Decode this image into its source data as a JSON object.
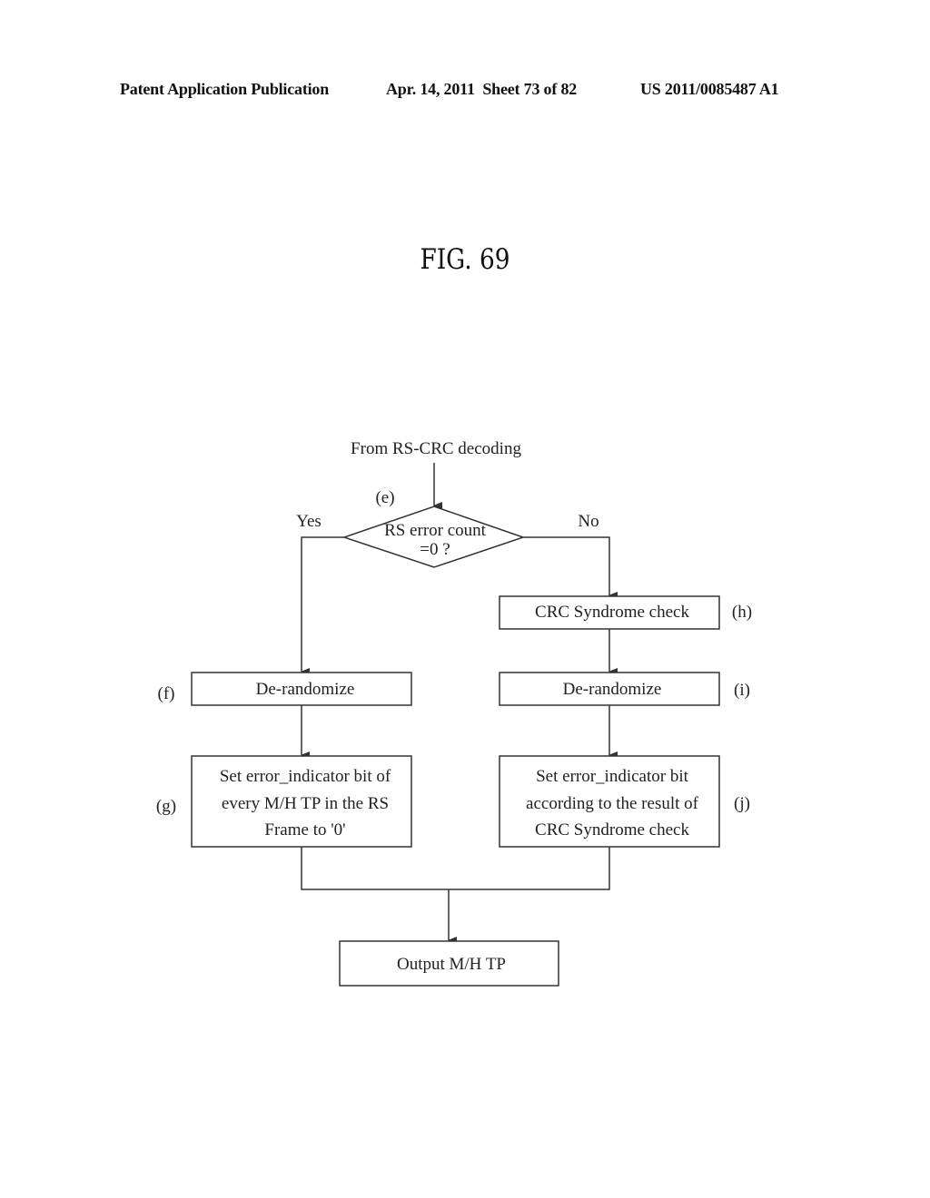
{
  "header": {
    "publication": "Patent Application Publication",
    "date_sheet": "Apr. 14, 2011  Sheet 73 of 82",
    "patent_number": "US 2011/0085487 A1"
  },
  "figure": {
    "title": "FIG. 69"
  },
  "flowchart": {
    "start_label": "From RS-CRC decoding",
    "decision": {
      "step": "(e)",
      "lines": [
        "RS error count",
        "=0 ?"
      ],
      "yes_label": "Yes",
      "no_label": "No"
    },
    "yes_branch": [
      {
        "step": "(f)",
        "lines": [
          "De-randomize"
        ]
      },
      {
        "step": "(g)",
        "lines": [
          "Set error_indicator bit of",
          "every M/H TP in the RS",
          "Frame to '0'"
        ]
      }
    ],
    "no_branch": [
      {
        "step": "(h)",
        "lines": [
          "CRC Syndrome check"
        ]
      },
      {
        "step": "(i)",
        "lines": [
          "De-randomize"
        ]
      },
      {
        "step": "(j)",
        "lines": [
          "Set error_indicator bit",
          "according to the result of",
          "CRC Syndrome check"
        ]
      }
    ],
    "output": {
      "lines": [
        "Output M/H TP"
      ]
    }
  }
}
